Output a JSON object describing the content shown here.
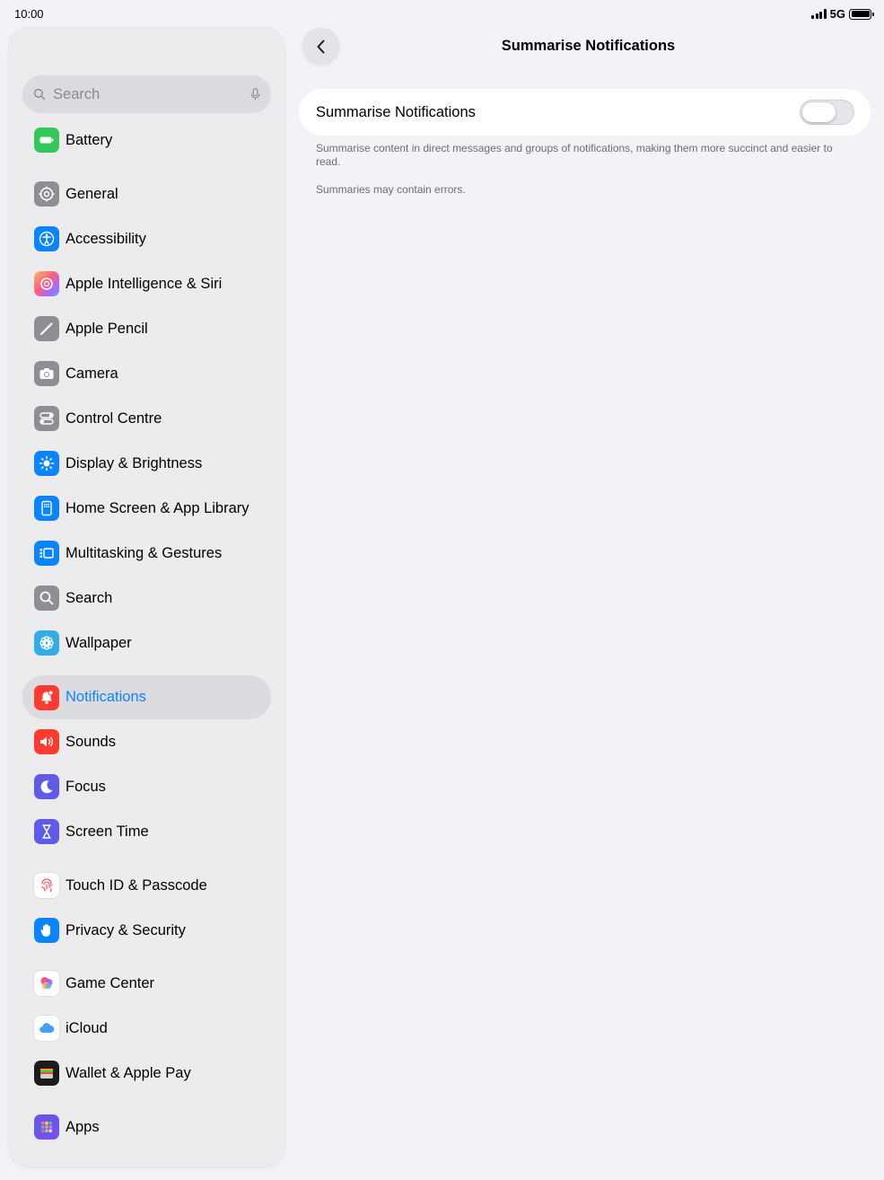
{
  "status_bar": {
    "time": "10:00",
    "network": "5G"
  },
  "search": {
    "placeholder": "Search"
  },
  "sidebar": {
    "items": [
      {
        "label": "Battery",
        "icon": "battery-icon",
        "color": "#34c759"
      },
      {
        "label": "General",
        "icon": "gear-icon",
        "color": "#8e8e93"
      },
      {
        "label": "Accessibility",
        "icon": "accessibility-icon",
        "color": "#0a84ff"
      },
      {
        "label": "Apple Intelligence & Siri",
        "icon": "apple-intelligence-icon",
        "color": "#ff6b6b"
      },
      {
        "label": "Apple Pencil",
        "icon": "pencil-icon",
        "color": "#8e8e93"
      },
      {
        "label": "Camera",
        "icon": "camera-icon",
        "color": "#8e8e93"
      },
      {
        "label": "Control Centre",
        "icon": "toggles-icon",
        "color": "#8e8e93"
      },
      {
        "label": "Display & Brightness",
        "icon": "sun-icon",
        "color": "#0a84ff"
      },
      {
        "label": "Home Screen & App Library",
        "icon": "home-screen-icon",
        "color": "#0a84ff"
      },
      {
        "label": "Multitasking & Gestures",
        "icon": "multitasking-icon",
        "color": "#0a84ff"
      },
      {
        "label": "Search",
        "icon": "search-icon",
        "color": "#8e8e93"
      },
      {
        "label": "Wallpaper",
        "icon": "flower-icon",
        "color": "#32ade6"
      },
      {
        "label": "Notifications",
        "icon": "bell-icon",
        "color": "#ff3b30",
        "selected": true
      },
      {
        "label": "Sounds",
        "icon": "speaker-icon",
        "color": "#ff3b30"
      },
      {
        "label": "Focus",
        "icon": "moon-icon",
        "color": "#5e5ce6"
      },
      {
        "label": "Screen Time",
        "icon": "hourglass-icon",
        "color": "#5e5ce6"
      },
      {
        "label": "Touch ID & Passcode",
        "icon": "fingerprint-icon",
        "color": "#ffffff"
      },
      {
        "label": "Privacy & Security",
        "icon": "hand-icon",
        "color": "#0a84ff"
      },
      {
        "label": "Game Center",
        "icon": "game-center-icon",
        "color": "#ffffff"
      },
      {
        "label": "iCloud",
        "icon": "cloud-icon",
        "color": "#ffffff"
      },
      {
        "label": "Wallet & Apple Pay",
        "icon": "wallet-icon",
        "color": "#1c1c1e"
      },
      {
        "label": "Apps",
        "icon": "apps-grid-icon",
        "color": "#5e5ce6"
      }
    ]
  },
  "detail": {
    "title": "Summarise Notifications",
    "setting_label": "Summarise Notifications",
    "toggle_on": false,
    "footnote_1": "Summarise content in direct messages and groups of notifications, making them more succinct and easier to read.",
    "footnote_2": "Summaries may contain errors."
  }
}
